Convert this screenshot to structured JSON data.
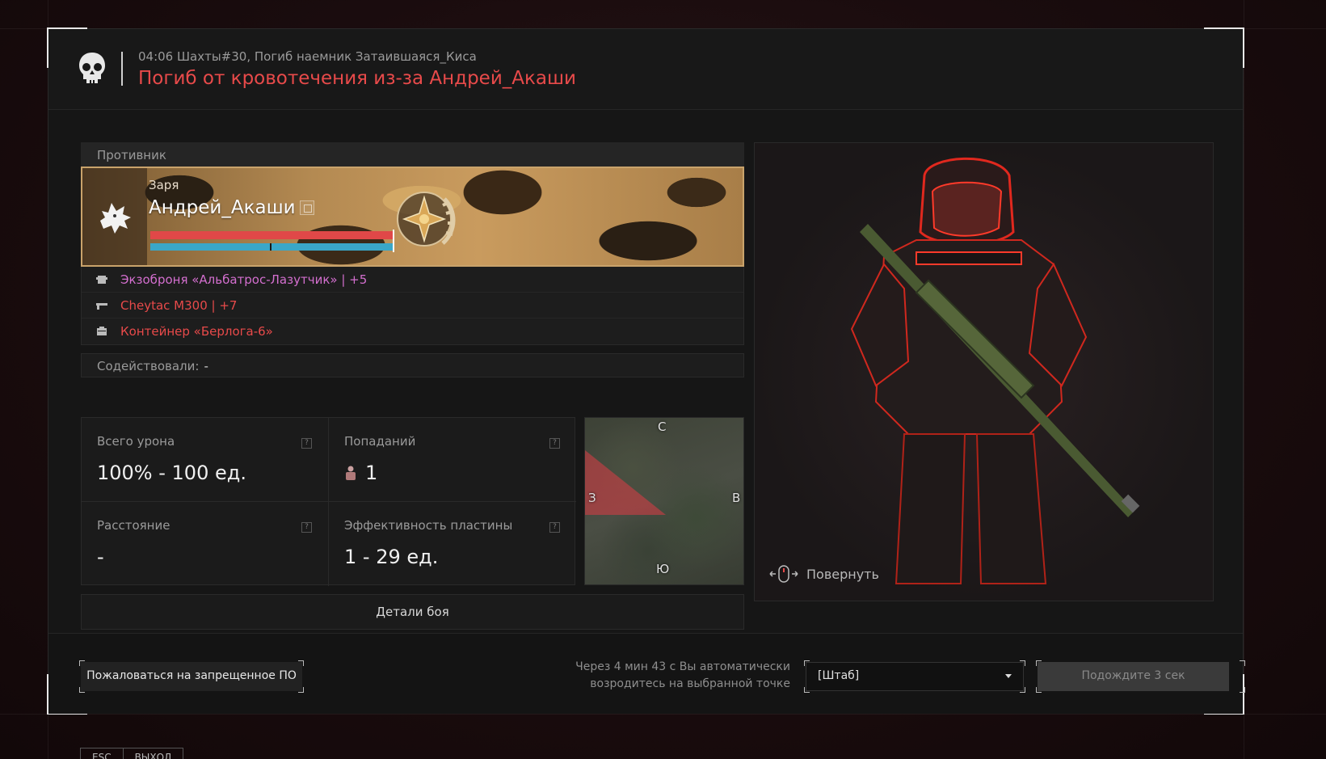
{
  "header": {
    "subtitle": "04:06 Шахты#30, Погиб наемник Затаившаяся_Киса",
    "title": "Погиб от кровотечения из-за Андрей_Акаши"
  },
  "opponent": {
    "section_label": "Противник",
    "clan": "Заря",
    "name": "Андрей_Акаши",
    "health_fraction": 1.0,
    "armor_fraction": 1.0,
    "items": [
      {
        "icon": "armor-icon",
        "label": "Экзоброня «Альбатрос-Лазутчик» | +5"
      },
      {
        "icon": "rifle-icon",
        "label": "Cheytac M300 | +7"
      },
      {
        "icon": "container-icon",
        "label": "Контейнер «Берлога-6»"
      }
    ]
  },
  "assist": {
    "label": "Содействовали:",
    "value": "-"
  },
  "stats": {
    "total_damage_label": "Всего урона",
    "total_damage_value": "100% - 100 ед.",
    "hits_label": "Попаданий",
    "hits_value": "1",
    "distance_label": "Расстояние",
    "distance_value": "-",
    "plate_label": "Эффективность пластины",
    "plate_value": "1 - 29 ед.",
    "help_glyph": "?"
  },
  "minimap": {
    "north": "С",
    "south": "Ю",
    "west": "З",
    "east": "В"
  },
  "details_button": "Детали боя",
  "viewer": {
    "rotate_label": "Повернуть"
  },
  "footer": {
    "report_button": "Пожаловаться на запрещенное ПО",
    "respawn_text_line1": "Через 4 мин 43 с Вы автоматически",
    "respawn_text_line2": "возродитесь на выбранной точке",
    "spawn_point": "[Штаб]",
    "wait_button": "Подождите 3 сек"
  },
  "bottom_tabs": [
    "ESC",
    "ВЫХОД"
  ],
  "colors": {
    "accent_red": "#e84a4a",
    "armor_purple": "#d46fcf",
    "armor_bar": "#3aa7c8",
    "banner_border": "#c9a36b"
  }
}
